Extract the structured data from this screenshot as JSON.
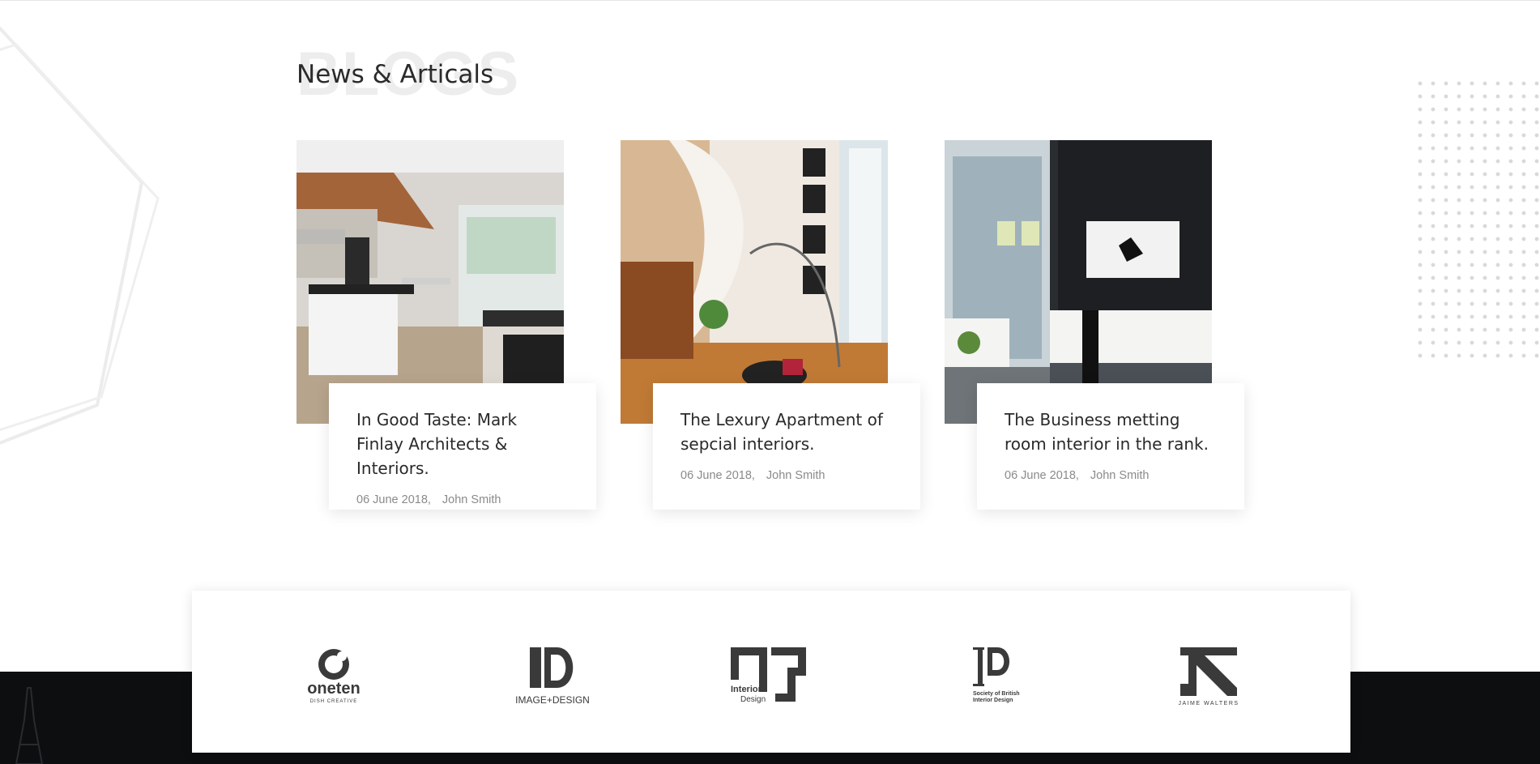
{
  "section": {
    "background_title": "BLOGS",
    "title": "News & Articals"
  },
  "posts": [
    {
      "title": "In Good Taste: Mark Finlay Architects & Interiors.",
      "date": "06 June 2018,",
      "author": "John Smith"
    },
    {
      "title": "The Lexury Apartment of sepcial interiors.",
      "date": "06 June 2018,",
      "author": "John Smith"
    },
    {
      "title": "The Business metting room interior in the rank.",
      "date": "06 June 2018,",
      "author": "John Smith"
    }
  ],
  "partners": [
    {
      "name": "oneten",
      "tagline": "DISH CREATIVE"
    },
    {
      "name": "IMAGE+DESIGN"
    },
    {
      "name": "Interior",
      "tagline": "Design"
    },
    {
      "name": "Society of British",
      "tagline": "Interior Design"
    },
    {
      "name": "JAIME WALTERS"
    }
  ],
  "colors": {
    "text": "#2a2a2a",
    "meta": "#8a8a8a",
    "dark_band": "#0d0e10",
    "logo": "#3a3a3a"
  }
}
